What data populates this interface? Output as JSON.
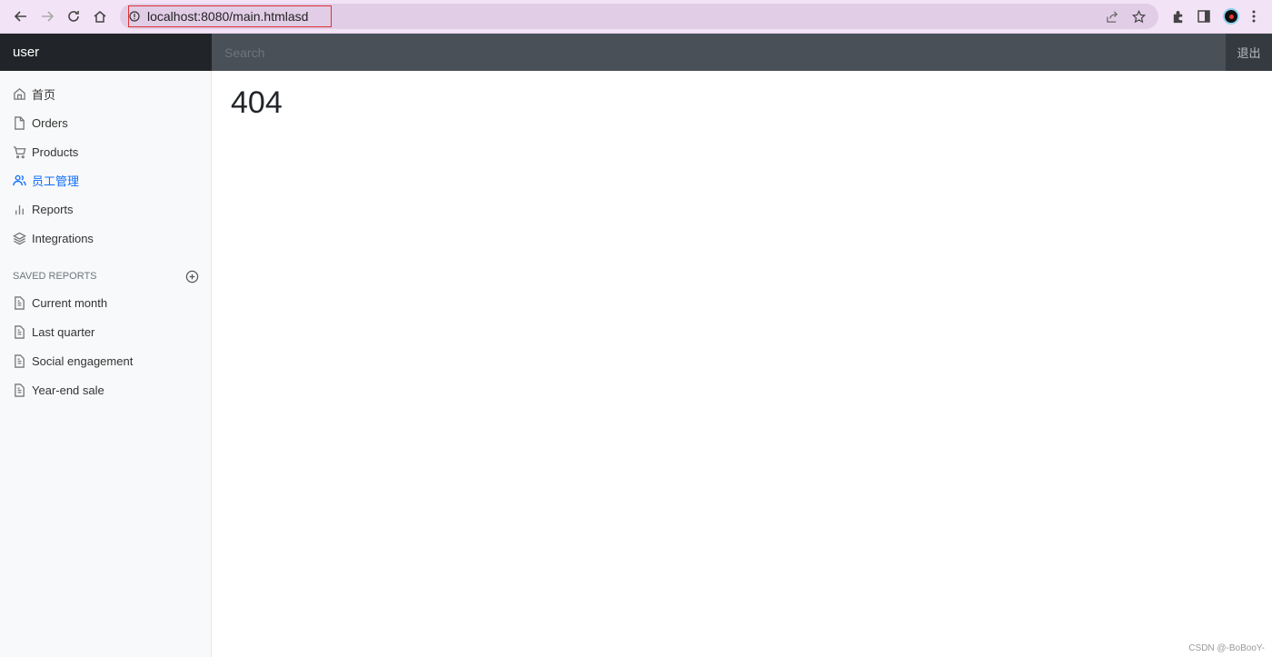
{
  "browser": {
    "url": "localhost:8080/main.htmlasd"
  },
  "header": {
    "brand": "user",
    "search_placeholder": "Search",
    "signout_label": "退出"
  },
  "sidebar": {
    "items": [
      {
        "label": "首页",
        "icon": "home-icon"
      },
      {
        "label": "Orders",
        "icon": "file-icon"
      },
      {
        "label": "Products",
        "icon": "shopping-cart-icon"
      },
      {
        "label": "员工管理",
        "icon": "users-icon",
        "active": true
      },
      {
        "label": "Reports",
        "icon": "bar-chart-icon"
      },
      {
        "label": "Integrations",
        "icon": "layers-icon"
      }
    ],
    "saved_heading": "SAVED REPORTS",
    "saved": [
      {
        "label": "Current month"
      },
      {
        "label": "Last quarter"
      },
      {
        "label": "Social engagement"
      },
      {
        "label": "Year-end sale"
      }
    ]
  },
  "main": {
    "title": "404"
  },
  "watermark": "CSDN @-BoBooY-",
  "colors": {
    "accent": "#0d6efd",
    "topbar": "#343a40"
  }
}
